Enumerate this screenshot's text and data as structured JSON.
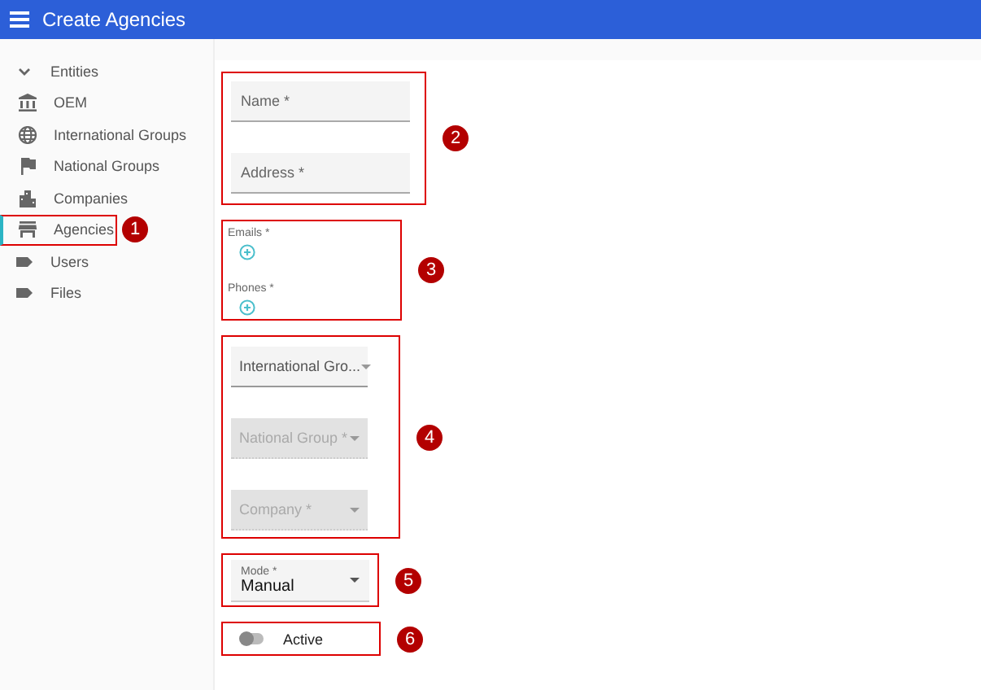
{
  "app_bar": {
    "title": "Create Agencies"
  },
  "sidebar": {
    "items": [
      {
        "label": "Entities",
        "kind": "chevron",
        "expanded": true,
        "selected": false,
        "children": [
          {
            "label": "OEM",
            "kind": "bank",
            "selected": false
          },
          {
            "label": "International Groups",
            "kind": "globe",
            "selected": false
          },
          {
            "label": "National Groups",
            "kind": "flag",
            "selected": false
          },
          {
            "label": "Companies",
            "kind": "building",
            "selected": false
          },
          {
            "label": "Agencies",
            "kind": "store",
            "selected": true,
            "callout": "1"
          }
        ]
      },
      {
        "label": "Users",
        "kind": "tag",
        "selected": false
      },
      {
        "label": "Files",
        "kind": "tag",
        "selected": false
      }
    ]
  },
  "form": {
    "groups": [
      {
        "callout": "2",
        "fields": [
          {
            "kind": "text",
            "placeholder": "Name *"
          },
          {
            "kind": "text",
            "placeholder": "Address *"
          }
        ]
      },
      {
        "callout": "3",
        "fields": [
          {
            "kind": "list",
            "label": "Emails *"
          },
          {
            "kind": "list",
            "label": "Phones *"
          }
        ]
      },
      {
        "callout": "4",
        "fields": [
          {
            "kind": "select",
            "label": "International Gro...",
            "disabled": false
          },
          {
            "kind": "select",
            "label": "National Group *",
            "disabled": true
          },
          {
            "kind": "select",
            "label": "Company *",
            "disabled": true
          }
        ]
      },
      {
        "callout": "5",
        "fields": [
          {
            "kind": "value-select",
            "label": "Mode *",
            "value": "Manual"
          }
        ]
      },
      {
        "callout": "6",
        "fields": [
          {
            "kind": "switch",
            "label": "Active",
            "on": false
          }
        ]
      }
    ]
  }
}
